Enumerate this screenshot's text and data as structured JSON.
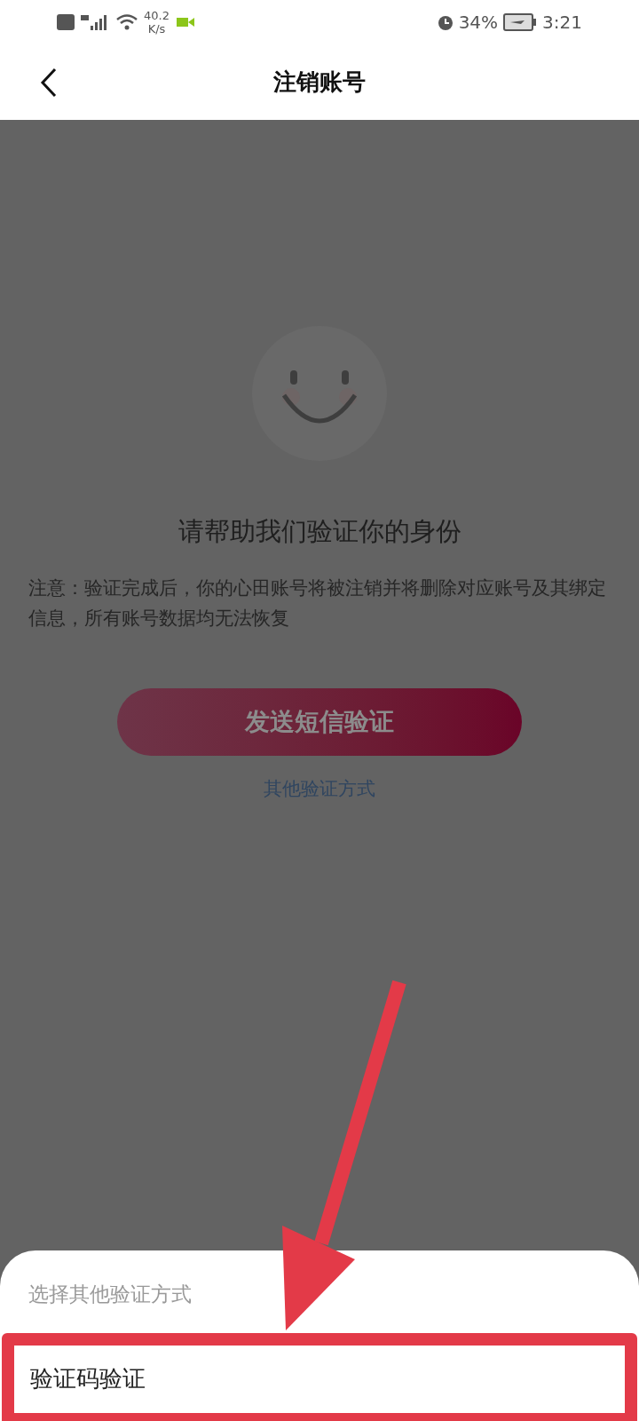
{
  "status_bar": {
    "speed": "40.2",
    "speed_unit": "K/s",
    "battery": "34%",
    "time": "3:21"
  },
  "header": {
    "title": "注销账号"
  },
  "verify": {
    "heading": "请帮助我们验证你的身份",
    "notice": "注意：验证完成后，你的心田账号将被注销并将删除对应账号及其绑定信息，所有账号数据均无法恢复",
    "primary_button": "发送短信验证",
    "other_link": "其他验证方式"
  },
  "sheet": {
    "title": "选择其他验证方式",
    "options": [
      {
        "label": "验证码验证",
        "selected": true
      }
    ]
  }
}
